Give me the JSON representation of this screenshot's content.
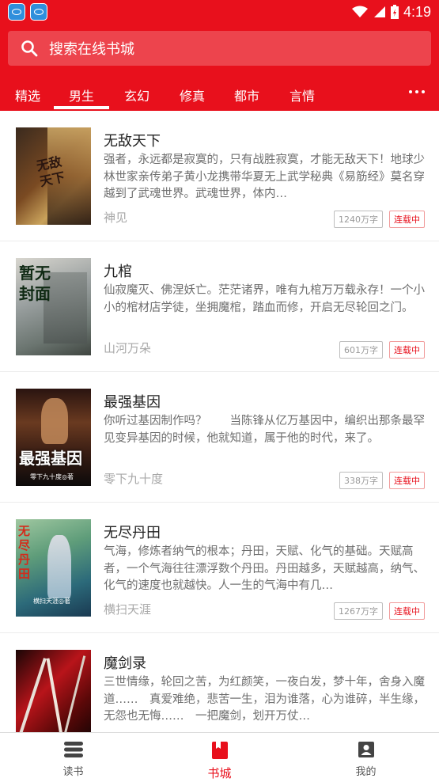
{
  "status_bar": {
    "time": "4:19"
  },
  "search": {
    "placeholder": "搜索在线书城"
  },
  "tabs": [
    {
      "label": "精选"
    },
    {
      "label": "男生"
    },
    {
      "label": "玄幻"
    },
    {
      "label": "修真"
    },
    {
      "label": "都市"
    },
    {
      "label": "言情"
    }
  ],
  "selected_tab": "男生",
  "books": [
    {
      "title": "无敌天下",
      "description": "强者，永远都是寂寞的，只有战胜寂寞，才能无敌天下！地球少林世家亲传弟子黄小龙携带华夏无上武学秘典《易筋经》莫名穿越到了武魂世界。武魂世界，体内…",
      "author": "神见",
      "word_count": "1240万字",
      "status": "连载中",
      "cover_text": "无敌天下"
    },
    {
      "title": "九棺",
      "description": "仙寂魔灭、佛涅妖亡。茫茫诸界，唯有九棺万万载永存！一个小小的棺材店学徒，坐拥魔棺，踏血而修，开启无尽轮回之门。",
      "author": "山河万朵",
      "word_count": "601万字",
      "status": "连载中",
      "cover_text": "暂无封面"
    },
    {
      "title": "最强基因",
      "description": "你听过基因制作吗？　　当陈锋从亿万基因中，编织出那条最罕见变异基因的时候，他就知道，属于他的时代，来了。",
      "author": "零下九十度",
      "word_count": "338万字",
      "status": "连载中",
      "cover_text": "最强基因",
      "cover_subtext": "零下九十度◎著"
    },
    {
      "title": "无尽丹田",
      "description": "气海，修炼者纳气的根本；丹田，天赋、化气的基础。天赋高者，一个气海往往漂浮数个丹田。丹田越多，天赋越高，纳气、化气的速度也就越快。人一生的气海中有几…",
      "author": "横扫天涯",
      "word_count": "1267万字",
      "status": "连载中",
      "cover_text": "无尽丹田",
      "cover_subtext": "横扫天涯◎著"
    },
    {
      "title": "魔剑录",
      "description": "三世情缘，轮回之苦，为红颜笑，一夜白发，梦十年，舍身入魔道……　真爱难绝，悲苦一生，泪为谁落，心为谁碎，半生缘，无怨也无悔……　一把魔剑，划开万仗…",
      "author": "",
      "word_count": "",
      "status": "",
      "cover_text": ""
    }
  ],
  "bottom_nav": [
    {
      "label": "读书",
      "icon": "bookshelf-icon"
    },
    {
      "label": "书城",
      "icon": "bookmark-icon"
    },
    {
      "label": "我的",
      "icon": "profile-icon"
    }
  ],
  "active_nav": "书城",
  "colors": {
    "primary": "#e8101c"
  }
}
